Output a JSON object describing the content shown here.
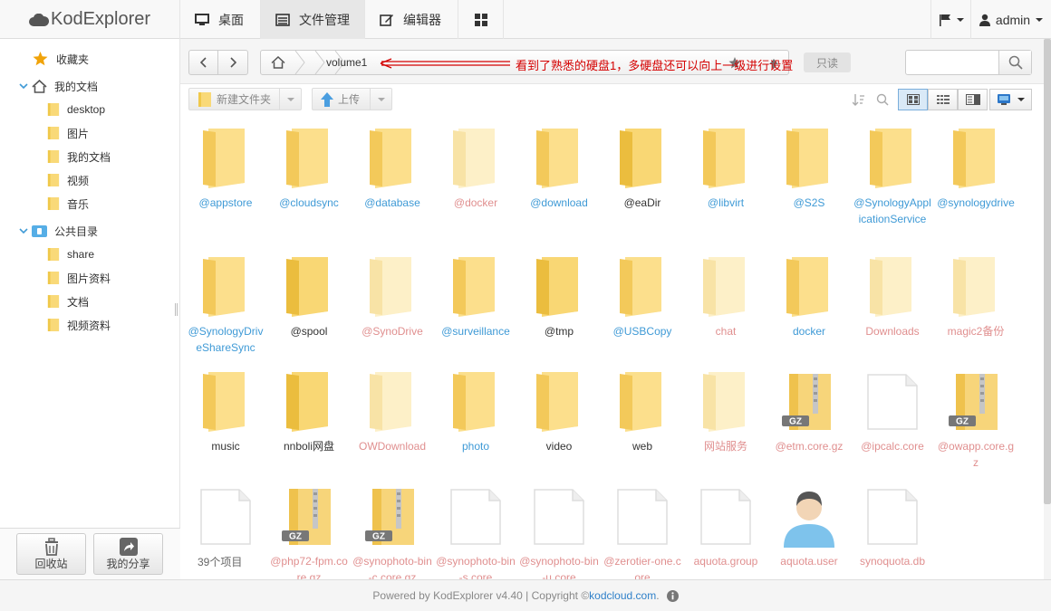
{
  "brand": {
    "name": "KodExplorer"
  },
  "nav": {
    "tabs": [
      {
        "label": "桌面",
        "icon": "monitor-icon"
      },
      {
        "label": "文件管理",
        "icon": "list-icon"
      },
      {
        "label": "编辑器",
        "icon": "edit-icon"
      },
      {
        "label": "",
        "icon": "grid-icon"
      }
    ],
    "user": "admin"
  },
  "sidebar": {
    "favorites": "收藏夹",
    "mydocs": "我的文档",
    "mydocs_children": [
      "desktop",
      "图片",
      "我的文档",
      "视频",
      "音乐"
    ],
    "public": "公共目录",
    "public_children": [
      "share",
      "图片资料",
      "文档",
      "视频资料"
    ],
    "recycle": "回收站",
    "share": "我的分享"
  },
  "pathbar": {
    "crumb": "volume1",
    "readonly": "只读"
  },
  "toolbar": {
    "new_folder": "新建文件夹",
    "upload": "上传"
  },
  "annotation": "看到了熟悉的硬盘1，多硬盘还可以向上一级进行设置",
  "status": {
    "count": "39个项目"
  },
  "files": [
    {
      "name": "@appstore",
      "type": "folder",
      "style": "normal",
      "color": "blue"
    },
    {
      "name": "@cloudsync",
      "type": "folder",
      "style": "normal",
      "color": "blue"
    },
    {
      "name": "@database",
      "type": "folder",
      "style": "normal",
      "color": "blue"
    },
    {
      "name": "@docker",
      "type": "folder",
      "style": "faded",
      "color": "pink"
    },
    {
      "name": "@download",
      "type": "folder",
      "style": "normal",
      "color": "blue"
    },
    {
      "name": "@eaDir",
      "type": "folder",
      "style": "strong",
      "color": "dark"
    },
    {
      "name": "@libvirt",
      "type": "folder",
      "style": "normal",
      "color": "blue"
    },
    {
      "name": "@S2S",
      "type": "folder",
      "style": "normal",
      "color": "blue"
    },
    {
      "name": "@SynologyApplicationService",
      "type": "folder",
      "style": "normal",
      "color": "blue"
    },
    {
      "name": "@synologydrive",
      "type": "folder",
      "style": "normal",
      "color": "blue"
    },
    {
      "name": "@SynologyDriveShareSync",
      "type": "folder",
      "style": "normal",
      "color": "blue"
    },
    {
      "name": "@spool",
      "type": "folder",
      "style": "strong",
      "color": "dark"
    },
    {
      "name": "@SynoDrive",
      "type": "folder",
      "style": "faded",
      "color": "pink"
    },
    {
      "name": "@surveillance",
      "type": "folder",
      "style": "normal",
      "color": "blue"
    },
    {
      "name": "@tmp",
      "type": "folder",
      "style": "strong",
      "color": "dark"
    },
    {
      "name": "@USBCopy",
      "type": "folder",
      "style": "normal",
      "color": "blue"
    },
    {
      "name": "chat",
      "type": "folder",
      "style": "faded",
      "color": "pink"
    },
    {
      "name": "docker",
      "type": "folder",
      "style": "normal",
      "color": "blue"
    },
    {
      "name": "Downloads",
      "type": "folder",
      "style": "faded",
      "color": "pink"
    },
    {
      "name": "magic2备份",
      "type": "folder",
      "style": "faded",
      "color": "pink"
    },
    {
      "name": "music",
      "type": "folder",
      "style": "normal",
      "color": "dark"
    },
    {
      "name": "nnboli网盘",
      "type": "folder",
      "style": "strong",
      "color": "dark"
    },
    {
      "name": "OWDownload",
      "type": "folder",
      "style": "faded",
      "color": "pink"
    },
    {
      "name": "photo",
      "type": "folder",
      "style": "normal",
      "color": "blue"
    },
    {
      "name": "video",
      "type": "folder",
      "style": "normal",
      "color": "dark"
    },
    {
      "name": "web",
      "type": "folder",
      "style": "normal",
      "color": "dark"
    },
    {
      "name": "网站服务",
      "type": "folder",
      "style": "faded",
      "color": "pink"
    },
    {
      "name": "@etm.core.gz",
      "type": "gz",
      "style": "normal",
      "color": "pink"
    },
    {
      "name": "@ipcalc.core",
      "type": "file",
      "style": "normal",
      "color": "pink"
    },
    {
      "name": "@owapp.core.gz",
      "type": "gz",
      "style": "normal",
      "color": "pink"
    },
    {
      "name": "",
      "type": "file",
      "style": "normal",
      "color": "pink"
    },
    {
      "name": "@php72-fpm.core.gz",
      "type": "gz",
      "style": "normal",
      "color": "pink"
    },
    {
      "name": "@synophoto-bin-c.core.gz",
      "type": "gz",
      "style": "normal",
      "color": "pink"
    },
    {
      "name": "@synophoto-bin-s.core",
      "type": "file",
      "style": "normal",
      "color": "pink"
    },
    {
      "name": "@synophoto-bin-u.core",
      "type": "file",
      "style": "normal",
      "color": "pink"
    },
    {
      "name": "@zerotier-one.core",
      "type": "file",
      "style": "normal",
      "color": "pink"
    },
    {
      "name": "aquota.group",
      "type": "file",
      "style": "normal",
      "color": "pink"
    },
    {
      "name": "aquota.user",
      "type": "user",
      "style": "normal",
      "color": "pink"
    },
    {
      "name": "synoquota.db",
      "type": "file",
      "style": "normal",
      "color": "pink"
    }
  ],
  "footer": {
    "text": "Powered by KodExplorer v4.40 | Copyright © ",
    "link": "kodcloud.com",
    "suffix": "."
  },
  "colors": {
    "blue": "#3f9ad6",
    "pink": "#e08f8f",
    "dark": "#333333",
    "accent": "#2f80c9"
  }
}
